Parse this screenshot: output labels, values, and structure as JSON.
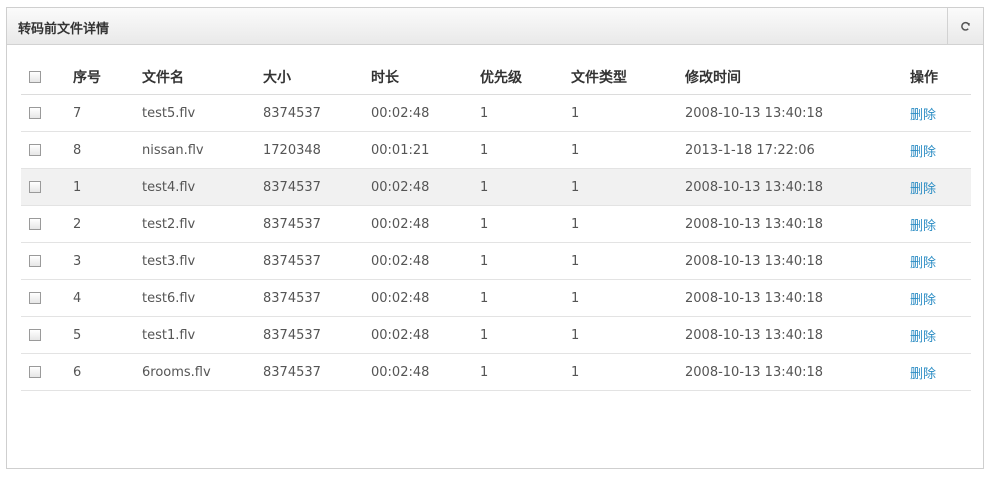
{
  "panel": {
    "title": "转码前文件详情",
    "refresh_icon": "refresh-icon"
  },
  "table": {
    "headers": [
      "序号",
      "文件名",
      "大小",
      "时长",
      "优先级",
      "文件类型",
      "修改时间",
      "操作"
    ],
    "rows": [
      {
        "no": "7",
        "name": "test5.flv",
        "size": "8374537",
        "duration": "00:02:48",
        "priority": "1",
        "type": "1",
        "mtime": "2008-10-13 13:40:18",
        "action": "删除"
      },
      {
        "no": "8",
        "name": "nissan.flv",
        "size": "1720348",
        "duration": "00:01:21",
        "priority": "1",
        "type": "1",
        "mtime": "2013-1-18 17:22:06",
        "action": "删除"
      },
      {
        "no": "1",
        "name": "test4.flv",
        "size": "8374537",
        "duration": "00:02:48",
        "priority": "1",
        "type": "1",
        "mtime": "2008-10-13 13:40:18",
        "action": "删除"
      },
      {
        "no": "2",
        "name": "test2.flv",
        "size": "8374537",
        "duration": "00:02:48",
        "priority": "1",
        "type": "1",
        "mtime": "2008-10-13 13:40:18",
        "action": "删除"
      },
      {
        "no": "3",
        "name": "test3.flv",
        "size": "8374537",
        "duration": "00:02:48",
        "priority": "1",
        "type": "1",
        "mtime": "2008-10-13 13:40:18",
        "action": "删除"
      },
      {
        "no": "4",
        "name": "test6.flv",
        "size": "8374537",
        "duration": "00:02:48",
        "priority": "1",
        "type": "1",
        "mtime": "2008-10-13 13:40:18",
        "action": "删除"
      },
      {
        "no": "5",
        "name": "test1.flv",
        "size": "8374537",
        "duration": "00:02:48",
        "priority": "1",
        "type": "1",
        "mtime": "2008-10-13 13:40:18",
        "action": "删除"
      },
      {
        "no": "6",
        "name": "6rooms.flv",
        "size": "8374537",
        "duration": "00:02:48",
        "priority": "1",
        "type": "1",
        "mtime": "2008-10-13 13:40:18",
        "action": "删除"
      }
    ]
  }
}
